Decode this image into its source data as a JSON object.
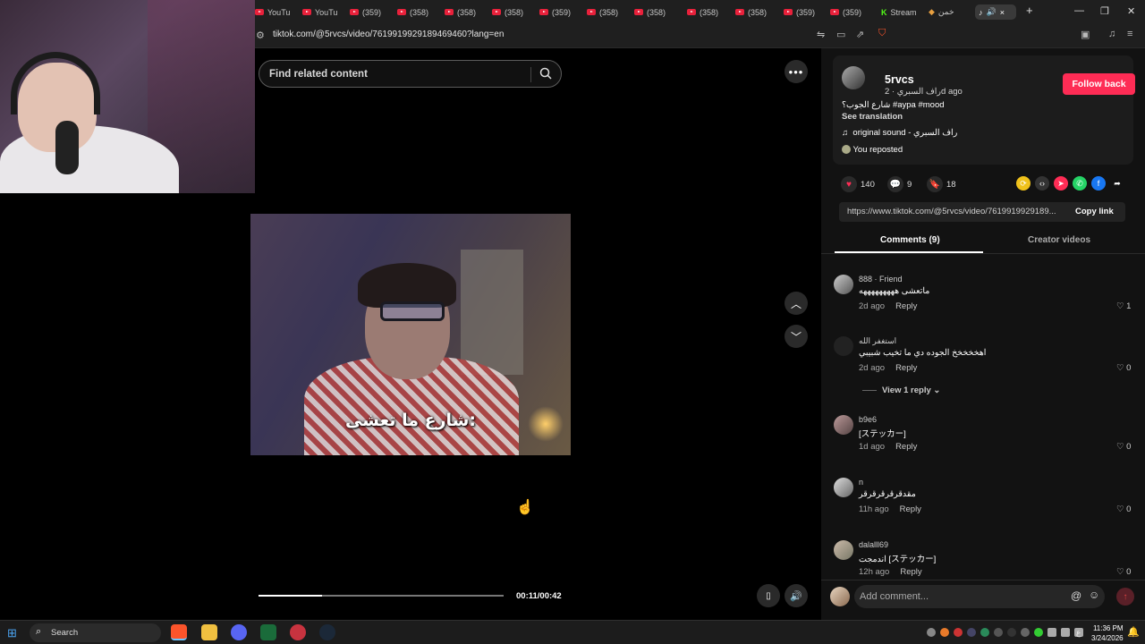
{
  "browser": {
    "tabs": [
      {
        "label": "YouTu",
        "icon": "youtube-icon"
      },
      {
        "label": "YouTu",
        "icon": "youtube-icon"
      },
      {
        "label": "(359)",
        "icon": "youtube-icon"
      },
      {
        "label": "(358)",
        "icon": "youtube-icon"
      },
      {
        "label": "(358)",
        "icon": "youtube-icon"
      },
      {
        "label": "(358)",
        "icon": "youtube-icon"
      },
      {
        "label": "(359)",
        "icon": "youtube-icon"
      },
      {
        "label": "(358)",
        "icon": "youtube-icon"
      },
      {
        "label": "(358)",
        "icon": "youtube-icon"
      },
      {
        "label": "(358)",
        "icon": "youtube-icon"
      },
      {
        "label": "(358)",
        "icon": "youtube-icon"
      },
      {
        "label": "(359)",
        "icon": "youtube-icon"
      },
      {
        "label": "(359)",
        "icon": "youtube-icon"
      },
      {
        "label": "Stream",
        "icon": "kick-icon"
      },
      {
        "label": "خمن",
        "icon": "game-icon"
      }
    ],
    "active_tab_close": "×",
    "new_tab": "+",
    "url": "tiktok.com/@5rvcs/video/7619919929189469460?lang=en"
  },
  "video": {
    "search_placeholder": "Find related content",
    "caption": "شارع ما تعشى:",
    "time": "00:11/00:42",
    "progress": 0.26
  },
  "post": {
    "username": "5rvcs",
    "display_name": "راف السبري",
    "age": "2d ago",
    "follow_label": "Follow back",
    "description": "شارع الجوب؟ #aypa #mood",
    "see_translation": "See translation",
    "sound": "original sound - راف السبري",
    "reposted": "You reposted",
    "likes": "140",
    "comments": "9",
    "saves": "18",
    "link": "https://www.tiktok.com/@5rvcs/video/7619919929189...",
    "copy_link": "Copy link",
    "tab_comments": "Comments (9)",
    "tab_creator": "Creator videos"
  },
  "comments": [
    {
      "name": "888 · Friend",
      "text": "ماتعشى هههههههههه",
      "age": "2d ago",
      "reply": "Reply",
      "likes": "1"
    },
    {
      "name": "استغفر الله",
      "text": "اهخخخخخ الجوده دي ما تخيب شبيبي",
      "age": "2d ago",
      "reply": "Reply",
      "likes": "0"
    },
    {
      "name": "b9e6",
      "text": "[ステッカー]",
      "age": "1d ago",
      "reply": "Reply",
      "likes": "0"
    },
    {
      "name": "n",
      "text": "مقدقرقرقرقرقر",
      "age": "11h ago",
      "reply": "Reply",
      "likes": "0"
    },
    {
      "name": "dalalll69",
      "text": "اندمجت [ステッカー]",
      "age": "12h ago",
      "reply": "Reply",
      "likes": "0"
    }
  ],
  "view_reply": "View 1 reply",
  "comment_placeholder": "Add comment...",
  "taskbar": {
    "search": "Search",
    "time": "11:36 PM",
    "date": "3/24/2026",
    "lang": "ع"
  },
  "colors": {
    "accent": "#fe2c55",
    "panel": "#121212"
  }
}
